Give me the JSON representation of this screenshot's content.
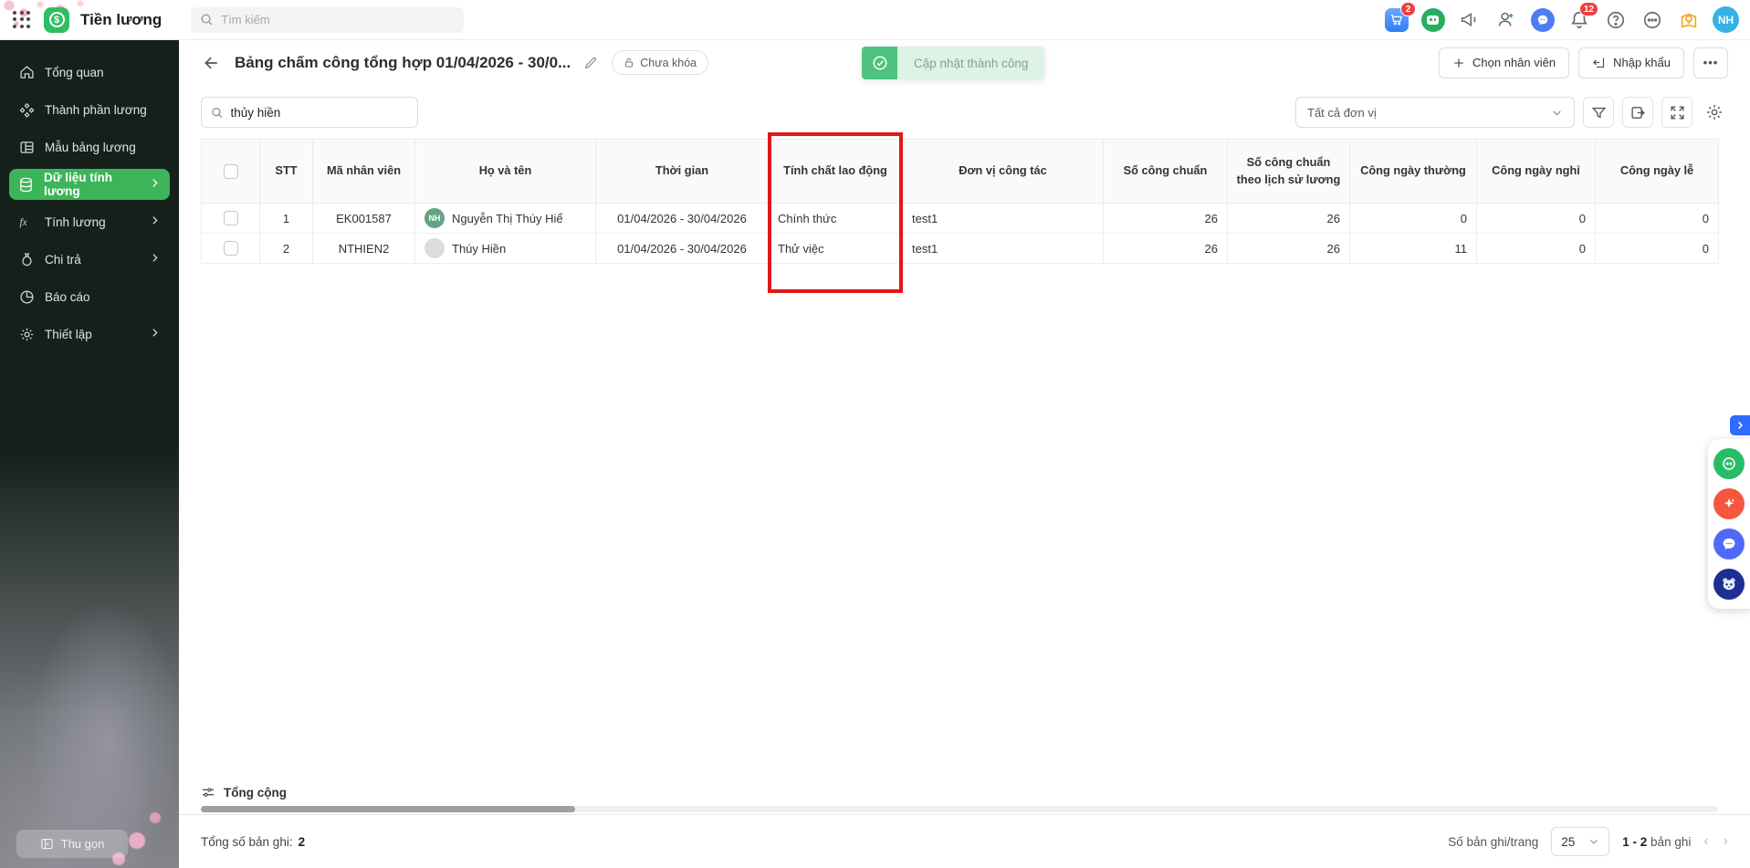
{
  "topbar": {
    "app_title": "Tiền lương",
    "search_placeholder": "Tìm kiếm",
    "cart_badge": "2",
    "bell_badge": "12",
    "avatar_initials": "NH"
  },
  "sidebar": {
    "items": [
      {
        "label": "Tổng quan",
        "icon": "home-icon",
        "expandable": false,
        "active": false
      },
      {
        "label": "Thành phần lương",
        "icon": "components-icon",
        "expandable": false,
        "active": false
      },
      {
        "label": "Mẫu bảng lương",
        "icon": "template-icon",
        "expandable": false,
        "active": false
      },
      {
        "label": "Dữ liệu tính lương",
        "icon": "database-icon",
        "expandable": true,
        "active": true
      },
      {
        "label": "Tính lương",
        "icon": "fx-icon",
        "expandable": true,
        "active": false
      },
      {
        "label": "Chi trả",
        "icon": "money-bag-icon",
        "expandable": true,
        "active": false
      },
      {
        "label": "Báo cáo",
        "icon": "pie-chart-icon",
        "expandable": false,
        "active": false
      },
      {
        "label": "Thiết lập",
        "icon": "gear-icon",
        "expandable": true,
        "active": false
      }
    ],
    "collapse_label": "Thu gọn"
  },
  "header": {
    "title": "Bảng chấm công tổng hợp 01/04/2026 - 30/0...",
    "lock_badge": "Chưa khóa",
    "toast_message": "Cập nhật thành công",
    "select_employee_button": "Chọn nhân viên",
    "import_button": "Nhập khẩu",
    "more_button": "•••"
  },
  "toolbar": {
    "search_value": "thủy hiền",
    "unit_filter_value": "Tất cả đơn vị"
  },
  "table": {
    "columns": [
      "STT",
      "Mã nhân viên",
      "Họ và tên",
      "Thời gian",
      "Tính chất lao động",
      "Đơn vị công tác",
      "Số công chuẩn",
      "Số công chuẩn theo lịch sử lương",
      "Công ngày thường",
      "Công ngày nghỉ",
      "Công ngày lễ"
    ],
    "rows": [
      {
        "stt": "1",
        "code": "EK001587",
        "avatar_initials": "NH",
        "name": "Nguyễn Thị Thúy Hiể",
        "time": "01/04/2026 - 30/04/2026",
        "labor_type": "Chính thức",
        "unit": "test1",
        "standard_days": "26",
        "standard_days_history": "26",
        "weekday_days": "0",
        "dayoff_days": "0",
        "holiday_days": "0"
      },
      {
        "stt": "2",
        "code": "NTHIEN2",
        "avatar_initials": "",
        "name": "Thúy Hiền",
        "time": "01/04/2026 - 30/04/2026",
        "labor_type": "Thử việc",
        "unit": "test1",
        "standard_days": "26",
        "standard_days_history": "26",
        "weekday_days": "11",
        "dayoff_days": "0",
        "holiday_days": "0"
      }
    ],
    "summary_label": "Tổng cộng"
  },
  "footer": {
    "total_label": "Tổng số bản ghi:",
    "total_value": "2",
    "per_page_label": "Số bản ghi/trang",
    "per_page_value": "25",
    "range_numbers": "1 - 2",
    "range_suffix": "bản ghi",
    "prev_icon": "‹",
    "next_icon": "›"
  },
  "colors": {
    "sidebar_active_green": "#3cb45a",
    "toast_green": "#4dc47d",
    "toast_light_green": "#def2e6",
    "badge_red": "#f03e3e",
    "annotation_red": "#e01818",
    "avatar_blue": "#35b2e5",
    "app_icon_green": "#2fbe62"
  }
}
